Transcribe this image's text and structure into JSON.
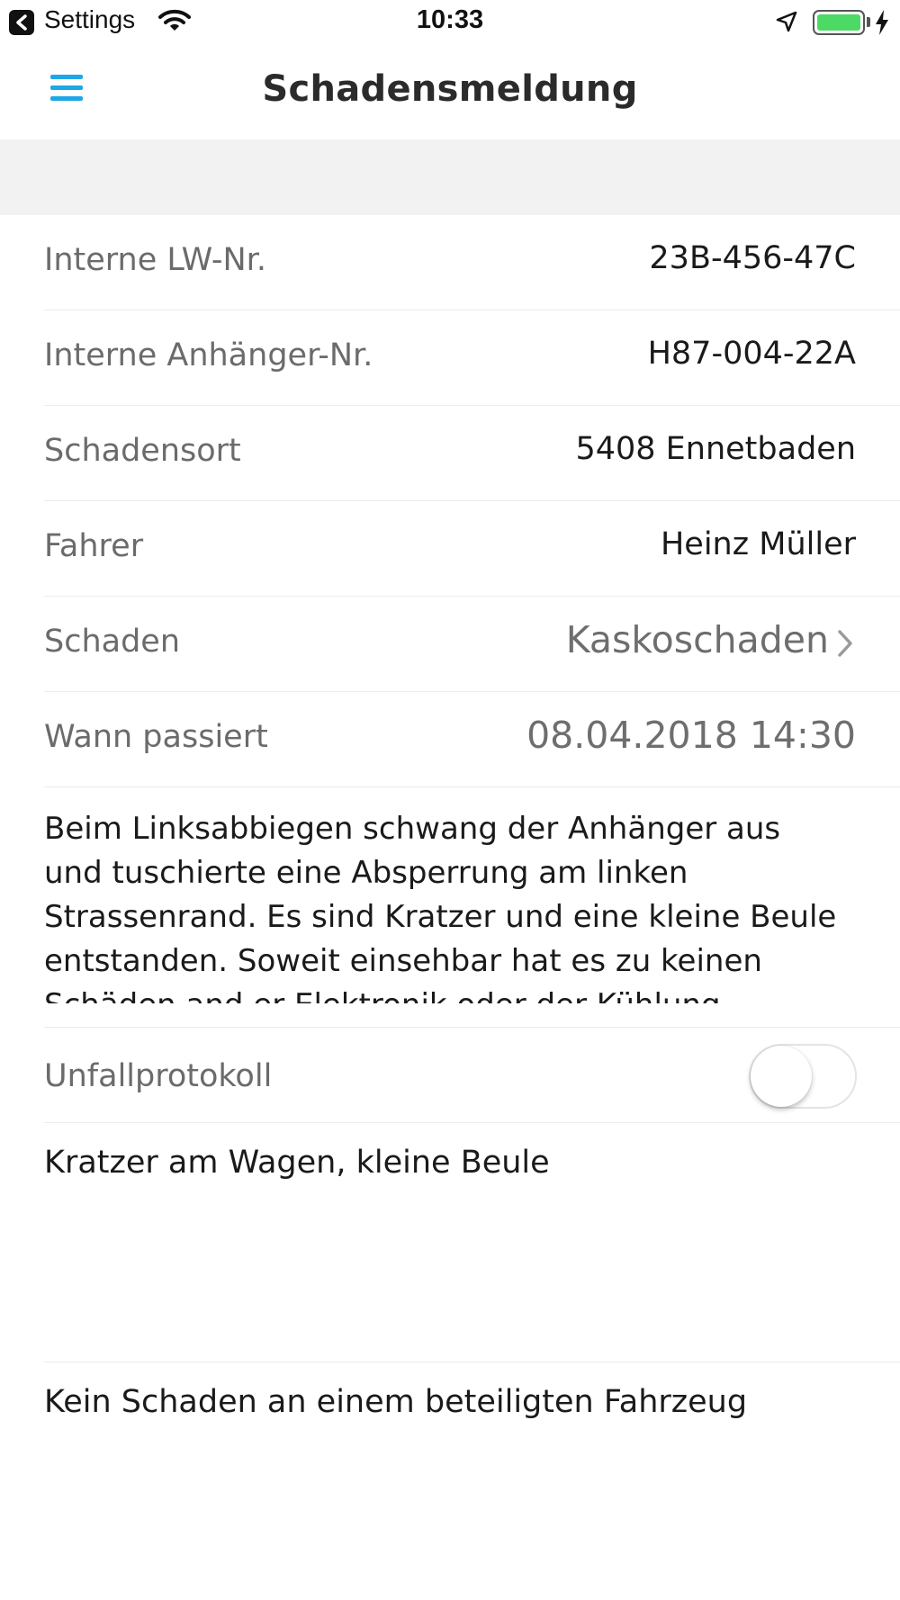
{
  "status_bar": {
    "back_app": "Settings",
    "time": "10:33",
    "battery_color": "#4cd964"
  },
  "nav": {
    "title": "Schadensmeldung",
    "menu_icon": "hamburger-menu-icon",
    "accent": "#1ea7e6"
  },
  "form": {
    "lw_nr": {
      "label": "Interne LW-Nr.",
      "value": "23B-456-47C"
    },
    "anhaenger_nr": {
      "label": "Interne Anhänger-Nr.",
      "value": "H87-004-22A"
    },
    "schadensort": {
      "label": "Schadensort",
      "value": "5408 Ennetbaden"
    },
    "fahrer": {
      "label": "Fahrer",
      "value": "Heinz Müller"
    },
    "schaden": {
      "label": "Schaden",
      "value": "Kaskoschaden"
    },
    "wann": {
      "label": "Wann passiert",
      "value": "08.04.2018 14:30"
    },
    "beschreibung": "Beim Linksabbiegen schwang der Anhänger aus und tuschierte eine Absperrung am linken Strassenrand. Es sind Kratzer und eine kleine Beule entstanden. Soweit einsehbar hat es zu keinen Schäden and er Elektronik oder der Kühlung geführt.",
    "unfallprotokoll": {
      "label": "Unfallprotokoll",
      "enabled": false
    },
    "schaden_eigen": "Kratzer am Wagen, kleine Beule",
    "schaden_fremd": "Kein Schaden an einem beteiligten Fahrzeug"
  }
}
